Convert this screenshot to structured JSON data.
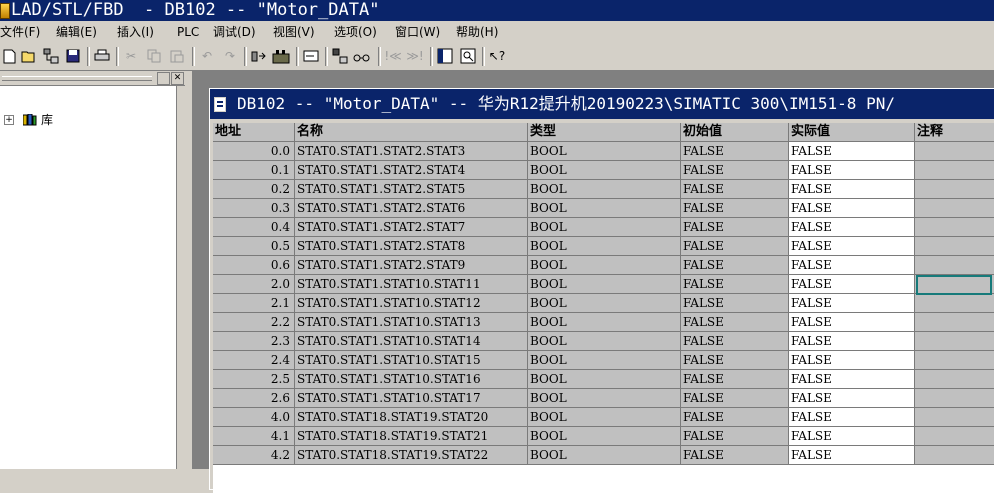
{
  "window": {
    "title": "LAD/STL/FBD  - DB102 -- \"Motor_DATA\""
  },
  "menu": [
    "文件(F)",
    "编辑(E)",
    "插入(I)",
    "PLC",
    "调试(D)",
    "视图(V)",
    "选项(O)",
    "窗口(W)",
    "帮助(H)"
  ],
  "toolbar": [
    "new-icon",
    "open-icon",
    "accessible-nodes-icon",
    "save-icon",
    "print-icon",
    "cut-icon",
    "copy-icon",
    "paste-icon",
    "undo-icon",
    "redo-icon",
    "load-icon",
    "monitor-icon",
    "declaration-icon",
    "download-icon",
    "glasses-icon",
    "prev-icon",
    "next-icon",
    "overview-icon",
    "zoom-icon",
    "help-icon"
  ],
  "tree": {
    "root_expander": "+",
    "root_label": "库"
  },
  "editor": {
    "title": "DB102 -- \"Motor_DATA\" -- 华为R12提升机20190223\\SIMATIC 300\\IM151-8 PN/",
    "columns": [
      "地址",
      "名称",
      "类型",
      "初始值",
      "实际值",
      "注释"
    ],
    "rows": [
      {
        "address": "0.0",
        "name": "STAT0.STAT1.STAT2.STAT3",
        "type": "BOOL",
        "initial": "FALSE",
        "actual": "FALSE",
        "comment": ""
      },
      {
        "address": "0.1",
        "name": "STAT0.STAT1.STAT2.STAT4",
        "type": "BOOL",
        "initial": "FALSE",
        "actual": "FALSE",
        "comment": ""
      },
      {
        "address": "0.2",
        "name": "STAT0.STAT1.STAT2.STAT5",
        "type": "BOOL",
        "initial": "FALSE",
        "actual": "FALSE",
        "comment": ""
      },
      {
        "address": "0.3",
        "name": "STAT0.STAT1.STAT2.STAT6",
        "type": "BOOL",
        "initial": "FALSE",
        "actual": "FALSE",
        "comment": ""
      },
      {
        "address": "0.4",
        "name": "STAT0.STAT1.STAT2.STAT7",
        "type": "BOOL",
        "initial": "FALSE",
        "actual": "FALSE",
        "comment": ""
      },
      {
        "address": "0.5",
        "name": "STAT0.STAT1.STAT2.STAT8",
        "type": "BOOL",
        "initial": "FALSE",
        "actual": "FALSE",
        "comment": ""
      },
      {
        "address": "0.6",
        "name": "STAT0.STAT1.STAT2.STAT9",
        "type": "BOOL",
        "initial": "FALSE",
        "actual": "FALSE",
        "comment": ""
      },
      {
        "address": "2.0",
        "name": "STAT0.STAT1.STAT10.STAT11",
        "type": "BOOL",
        "initial": "FALSE",
        "actual": "FALSE",
        "comment": ""
      },
      {
        "address": "2.1",
        "name": "STAT0.STAT1.STAT10.STAT12",
        "type": "BOOL",
        "initial": "FALSE",
        "actual": "FALSE",
        "comment": ""
      },
      {
        "address": "2.2",
        "name": "STAT0.STAT1.STAT10.STAT13",
        "type": "BOOL",
        "initial": "FALSE",
        "actual": "FALSE",
        "comment": ""
      },
      {
        "address": "2.3",
        "name": "STAT0.STAT1.STAT10.STAT14",
        "type": "BOOL",
        "initial": "FALSE",
        "actual": "FALSE",
        "comment": ""
      },
      {
        "address": "2.4",
        "name": "STAT0.STAT1.STAT10.STAT15",
        "type": "BOOL",
        "initial": "FALSE",
        "actual": "FALSE",
        "comment": ""
      },
      {
        "address": "2.5",
        "name": "STAT0.STAT1.STAT10.STAT16",
        "type": "BOOL",
        "initial": "FALSE",
        "actual": "FALSE",
        "comment": ""
      },
      {
        "address": "2.6",
        "name": "STAT0.STAT1.STAT10.STAT17",
        "type": "BOOL",
        "initial": "FALSE",
        "actual": "FALSE",
        "comment": ""
      },
      {
        "address": "4.0",
        "name": "STAT0.STAT18.STAT19.STAT20",
        "type": "BOOL",
        "initial": "FALSE",
        "actual": "FALSE",
        "comment": ""
      },
      {
        "address": "4.1",
        "name": "STAT0.STAT18.STAT19.STAT21",
        "type": "BOOL",
        "initial": "FALSE",
        "actual": "FALSE",
        "comment": ""
      },
      {
        "address": "4.2",
        "name": "STAT0.STAT18.STAT19.STAT22",
        "type": "BOOL",
        "initial": "FALSE",
        "actual": "FALSE",
        "comment": ""
      }
    ]
  },
  "colors": {
    "title_bar": "#0a246a",
    "grid_grey": "#c0c0c0",
    "selection": "#167a7a"
  }
}
